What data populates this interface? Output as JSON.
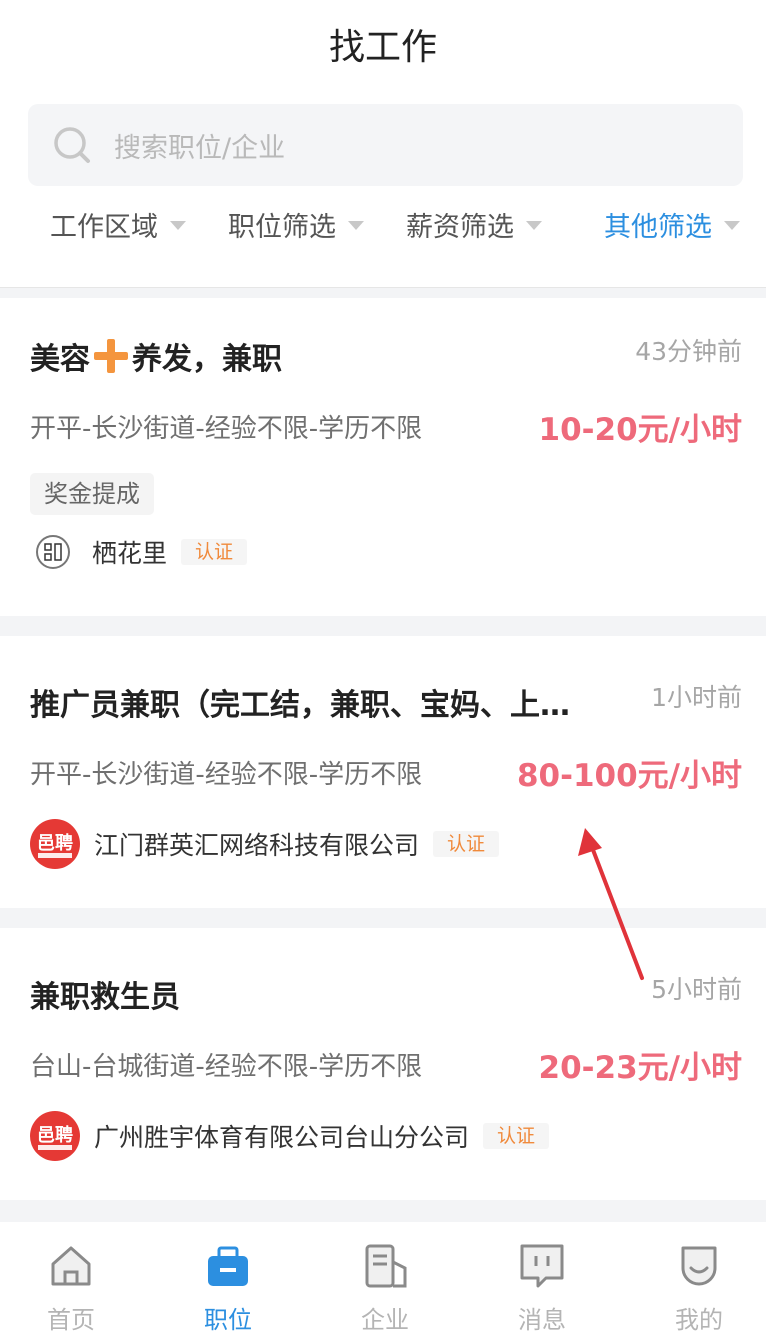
{
  "header": {
    "title": "找工作",
    "search_placeholder": "搜索职位/企业",
    "filters": [
      {
        "label": "工作区域",
        "active": false
      },
      {
        "label": "职位筛选",
        "active": false
      },
      {
        "label": "薪资筛选",
        "active": false
      },
      {
        "label": "其他筛选",
        "active": true
      }
    ]
  },
  "jobs": [
    {
      "title_part1": "美容",
      "title_part2": "养发，兼职",
      "time": "43分钟前",
      "meta": "开平-长沙街道-经验不限-学历不限",
      "salary": "10-20元/小时",
      "tag": "奖金提成",
      "company": "栖花里",
      "badge": "认证"
    },
    {
      "title": "推广员兼职（完工结，兼职、宝妈、上…",
      "time": "1小时前",
      "meta": "开平-长沙街道-经验不限-学历不限",
      "salary": "80-100元/小时",
      "company": "江门群英汇网络科技有限公司",
      "badge": "认证"
    },
    {
      "title": "兼职救生员",
      "time": "5小时前",
      "meta": "台山-台城街道-经验不限-学历不限",
      "salary": "20-23元/小时",
      "company": "广州胜宇体育有限公司台山分公司",
      "badge": "认证"
    }
  ],
  "tabs": [
    {
      "label": "首页",
      "icon": "home-icon",
      "active": false
    },
    {
      "label": "职位",
      "icon": "briefcase-icon",
      "active": true
    },
    {
      "label": "企业",
      "icon": "building-icon",
      "active": false
    },
    {
      "label": "消息",
      "icon": "message-icon",
      "active": false
    },
    {
      "label": "我的",
      "icon": "profile-icon",
      "active": false
    }
  ],
  "colors": {
    "accent": "#2c8fe0",
    "salary": "#ee6a7b",
    "badge": "#f08a3c",
    "annotation_arrow": "#e0333a"
  }
}
